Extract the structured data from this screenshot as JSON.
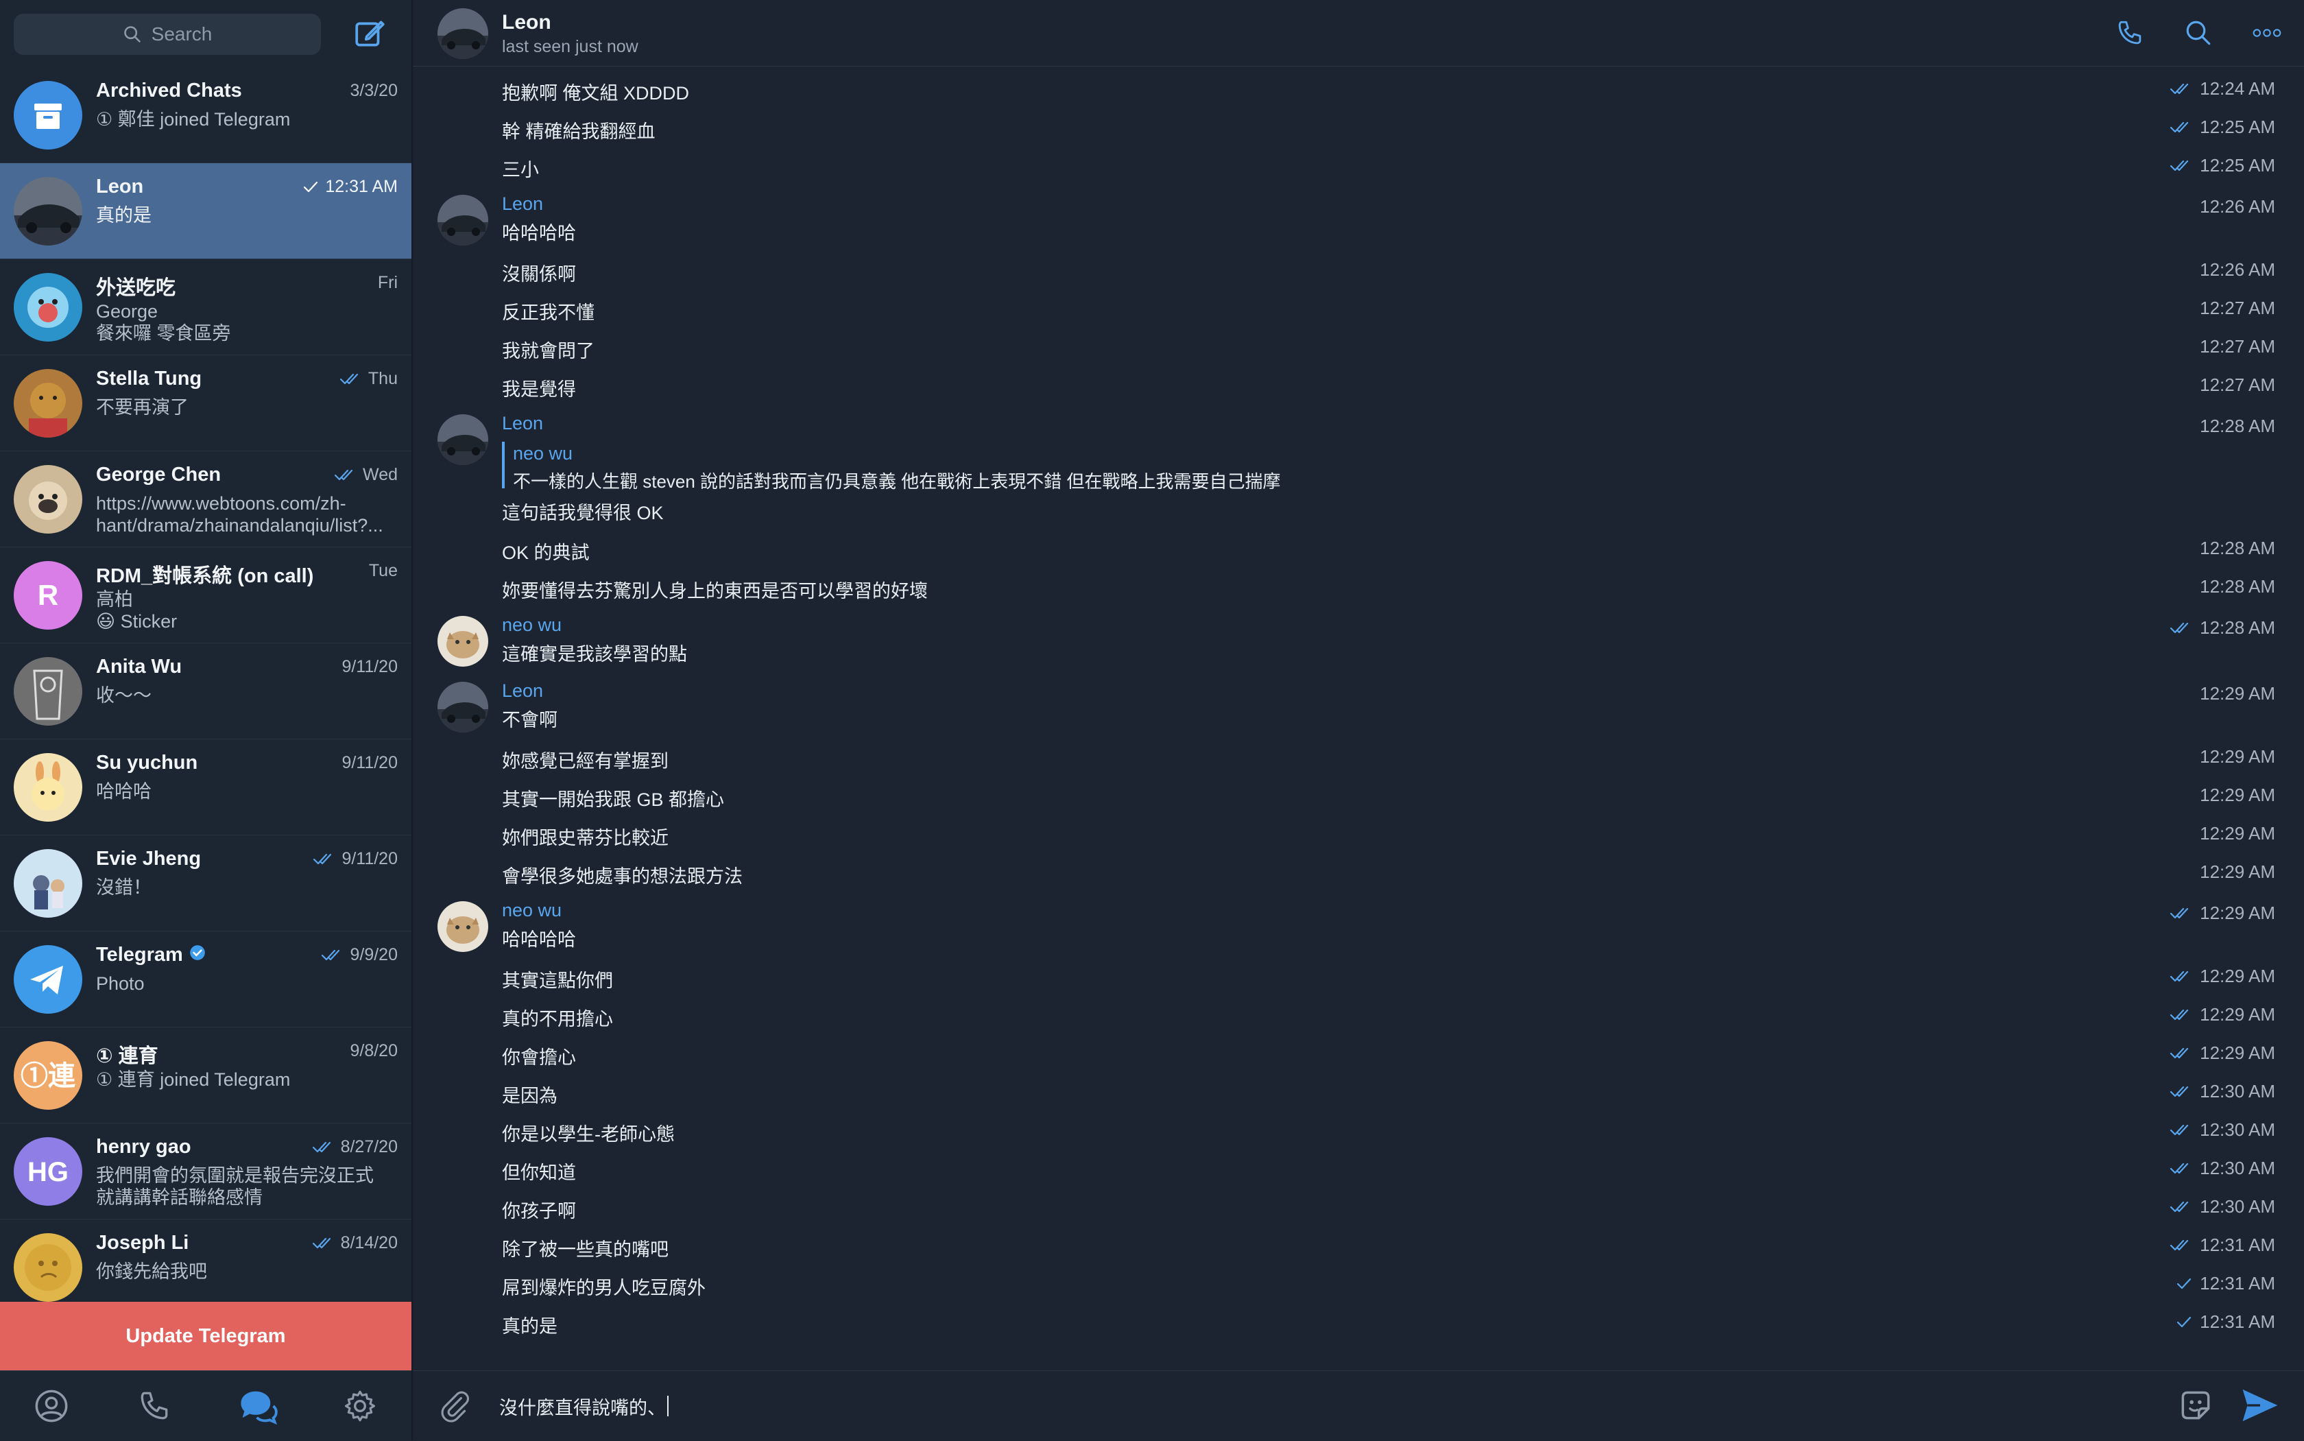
{
  "colors": {
    "accent": "#5aa6ee",
    "active_chat_bg": "#4a6a96",
    "update_button_bg": "#e2625d",
    "background": "#1b2430"
  },
  "search": {
    "placeholder": "Search"
  },
  "chats": [
    {
      "name": "Archived Chats",
      "meta": "3/3/20",
      "checks": 0,
      "lines": [
        "① 鄭佳 joined Telegram"
      ],
      "avatar_icon": "archive-icon",
      "avatar_color": "#3d8ee0"
    },
    {
      "name": "Leon",
      "meta": "12:31 AM",
      "checks": 1,
      "lines": [
        "真的是"
      ],
      "avatar_icon": "car-photo",
      "avatar_color": "#4b5566",
      "active": true
    },
    {
      "name": "外送吃吃",
      "meta": "Fri",
      "checks": 0,
      "lines": [
        "George",
        "餐來囉 零食區旁"
      ],
      "avatar_icon": "cartoon-photo",
      "avatar_color": "#2b93c9"
    },
    {
      "name": "Stella Tung",
      "meta": "Thu",
      "checks": 2,
      "lines": [
        "不要再演了"
      ],
      "avatar_icon": "dog-photo",
      "avatar_color": "#b07a3c"
    },
    {
      "name": "George Chen",
      "meta": "Wed",
      "checks": 2,
      "lines": [
        "https://www.webtoons.com/zh-",
        "hant/drama/zhainandalanqiu/list?..."
      ],
      "avatar_icon": "pug-photo",
      "avatar_color": "#cdb898"
    },
    {
      "name": "RDM_對帳系統 (on call)",
      "meta": "Tue",
      "checks": 0,
      "lines": [
        "高柏",
        "😃 Sticker"
      ],
      "avatar_icon": "initial-r",
      "avatar_initials": "R",
      "avatar_color": "#d97ee6"
    },
    {
      "name": "Anita Wu",
      "meta": "9/11/20",
      "checks": 0,
      "lines": [
        "收～～"
      ],
      "avatar_icon": "sketch-photo",
      "avatar_color": "#6f6f6f"
    },
    {
      "name": "Su yuchun",
      "meta": "9/11/20",
      "checks": 0,
      "lines": [
        "哈哈哈"
      ],
      "avatar_icon": "bunny-photo",
      "avatar_color": "#f3e3b5"
    },
    {
      "name": "Evie Jheng",
      "meta": "9/11/20",
      "checks": 2,
      "lines": [
        "沒錯！"
      ],
      "avatar_icon": "illustration-photo",
      "avatar_color": "#cfe4f3"
    },
    {
      "name": "Telegram",
      "meta": "9/9/20",
      "checks": 2,
      "lines": [
        "Photo"
      ],
      "avatar_icon": "telegram-icon",
      "avatar_color": "#3d9be9",
      "verified": true
    },
    {
      "name": "① 連育",
      "meta": "9/8/20",
      "checks": 0,
      "lines": [
        "① 連育 joined Telegram"
      ],
      "avatar_icon": "initial-lian",
      "avatar_initials": "①連",
      "avatar_color": "#f0a969"
    },
    {
      "name": "henry gao",
      "meta": "8/27/20",
      "checks": 2,
      "lines": [
        "我們開會的氛圍就是報告完沒正式",
        "就講講幹話聯絡感情"
      ],
      "avatar_icon": "initial-hg",
      "avatar_initials": "HG",
      "avatar_color": "#8e7ee6"
    },
    {
      "name": "Joseph Li",
      "meta": "8/14/20",
      "checks": 2,
      "lines": [
        "你錢先給我吧"
      ],
      "avatar_icon": "moon-photo",
      "avatar_color": "#e0b64a"
    }
  ],
  "update_button": "Update Telegram",
  "header": {
    "name": "Leon",
    "status": "last seen just now"
  },
  "messages": [
    {
      "type": "plain",
      "text": "抱歉啊 俺文組 XDDDD",
      "time": "12:24 AM",
      "checks": 2
    },
    {
      "type": "plain",
      "text": "幹 精確給我翻經血",
      "time": "12:25 AM",
      "checks": 2
    },
    {
      "type": "plain",
      "text": "三小",
      "time": "12:25 AM",
      "checks": 2
    },
    {
      "type": "group",
      "sender": "Leon",
      "text": "哈哈哈哈",
      "time": "12:26 AM",
      "checks": 0,
      "avatar": "car"
    },
    {
      "type": "plain",
      "text": "沒關係啊",
      "time": "12:26 AM",
      "checks": 0
    },
    {
      "type": "plain",
      "text": "反正我不懂",
      "time": "12:27 AM",
      "checks": 0
    },
    {
      "type": "plain",
      "text": "我就會問了",
      "time": "12:27 AM",
      "checks": 0
    },
    {
      "type": "plain",
      "text": "我是覺得",
      "time": "12:27 AM",
      "checks": 0
    },
    {
      "type": "reply",
      "sender": "Leon",
      "reply_name": "neo wu",
      "reply_text": "不一樣的人生觀 steven 說的話對我而言仍具意義 他在戰術上表現不錯 但在戰略上我需要自己揣摩",
      "text": "這句話我覺得很 OK",
      "time": "12:28 AM",
      "checks": 0,
      "avatar": "car"
    },
    {
      "type": "plain",
      "text": "OK 的典試",
      "time": "12:28 AM",
      "checks": 0
    },
    {
      "type": "plain",
      "text": "妳要懂得去芬驚別人身上的東西是否可以學習的好壞",
      "time": "12:28 AM",
      "checks": 0
    },
    {
      "type": "group",
      "sender": "neo wu",
      "text": "這確實是我該學習的點",
      "time": "12:28 AM",
      "checks": 2,
      "avatar": "cat"
    },
    {
      "type": "group",
      "sender": "Leon",
      "text": "不會啊",
      "time": "12:29 AM",
      "checks": 0,
      "avatar": "car"
    },
    {
      "type": "plain",
      "text": "妳感覺已經有掌握到",
      "time": "12:29 AM",
      "checks": 0
    },
    {
      "type": "plain",
      "text": "其實一開始我跟 GB 都擔心",
      "time": "12:29 AM",
      "checks": 0
    },
    {
      "type": "plain",
      "text": "妳們跟史蒂芬比較近",
      "time": "12:29 AM",
      "checks": 0
    },
    {
      "type": "plain",
      "text": "會學很多她處事的想法跟方法",
      "time": "12:29 AM",
      "checks": 0
    },
    {
      "type": "group",
      "sender": "neo wu",
      "text": "哈哈哈哈",
      "time": "12:29 AM",
      "checks": 2,
      "avatar": "cat"
    },
    {
      "type": "plain",
      "text": "其實這點你們",
      "time": "12:29 AM",
      "checks": 2
    },
    {
      "type": "plain",
      "text": "真的不用擔心",
      "time": "12:29 AM",
      "checks": 2
    },
    {
      "type": "plain",
      "text": "你會擔心",
      "time": "12:29 AM",
      "checks": 2
    },
    {
      "type": "plain",
      "text": "是因為",
      "time": "12:30 AM",
      "checks": 2
    },
    {
      "type": "plain",
      "text": "你是以學生-老師心態",
      "time": "12:30 AM",
      "checks": 2
    },
    {
      "type": "plain",
      "text": "但你知道",
      "time": "12:30 AM",
      "checks": 2
    },
    {
      "type": "plain",
      "text": "你孩子啊",
      "time": "12:30 AM",
      "checks": 2
    },
    {
      "type": "plain",
      "text": "除了被一些真的嘴吧",
      "time": "12:31 AM",
      "checks": 2
    },
    {
      "type": "plain",
      "text": "屌到爆炸的男人吃豆腐外",
      "time": "12:31 AM",
      "checks": 1
    },
    {
      "type": "plain",
      "text": "真的是",
      "time": "12:31 AM",
      "checks": 1
    }
  ],
  "composer": {
    "value": "沒什麼直得說嘴的、"
  }
}
